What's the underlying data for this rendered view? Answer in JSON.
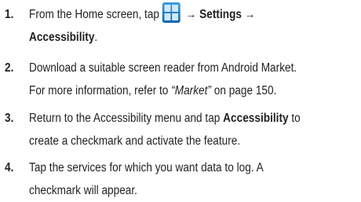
{
  "steps": [
    {
      "number": "1.",
      "part1": "From the Home screen, tap",
      "arrow1": "→",
      "settings": "Settings",
      "arrow2": "→",
      "accessibility": "Accessibility",
      "period": ".",
      "icon": "apps-grid-icon"
    },
    {
      "number": "2.",
      "line1": "Download a suitable screen reader from Android Market.",
      "line2_start": "For more information, refer to ",
      "market_ref": "“Market”",
      "line2_end": " on page 150."
    },
    {
      "number": "3.",
      "line1_start": "Return to the Accessibility menu and tap ",
      "accessibility_bold": "Accessibility",
      "line1_end": " to",
      "line2": "create a checkmark and activate the feature."
    },
    {
      "number": "4.",
      "line1": "Tap the services for which you want data to log. A",
      "line2": "checkmark will appear."
    }
  ],
  "colors": {
    "text": "#231f20",
    "icon_gradient_top": "#3a9ee2",
    "icon_gradient_bottom": "#0d63ad",
    "icon_cell": "#cfe8fb"
  }
}
